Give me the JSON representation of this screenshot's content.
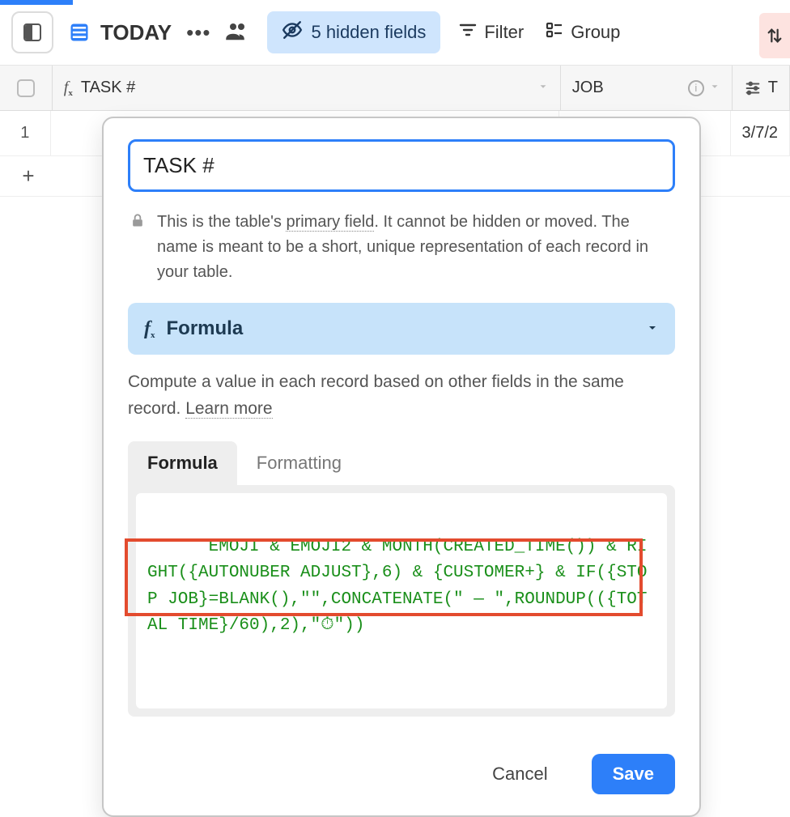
{
  "toolbar": {
    "view_name": "TODAY",
    "hidden_fields_label": "5 hidden fields",
    "filter_label": "Filter",
    "group_label": "Group"
  },
  "columns": {
    "task_label": "TASK #",
    "job_label": "JOB",
    "t_label": "T"
  },
  "rows": {
    "row1_num": "1",
    "row1_t_value": "3/7/2"
  },
  "popup": {
    "field_name_value": "TASK #",
    "primary_note_1": "This is the table's ",
    "primary_note_link": "primary field",
    "primary_note_2": ". It cannot be hidden or moved. The name is meant to be a short, unique representation of each record in your table.",
    "type_label": "Formula",
    "compute_note": "Compute a value in each record based on other fields in the same record. ",
    "learn_more": "Learn more",
    "tab_formula": "Formula",
    "tab_formatting": "Formatting",
    "formula_text": "EMOJI & EMOJI2 & MONTH(CREATED_TIME()) & RIGHT({AUTONUBER ADJUST},6) & {CUSTOMER+} & IF({STOP JOB}=BLANK(),\"\",CONCATENATE(\" — \",ROUNDUP(({TOTAL TIME}/60),2),\"⏱\"))",
    "cancel_label": "Cancel",
    "save_label": "Save"
  }
}
